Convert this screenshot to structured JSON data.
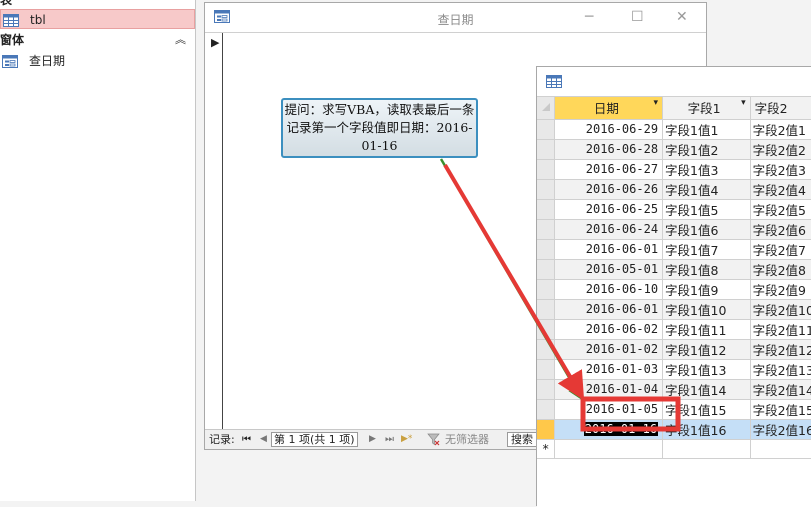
{
  "nav": {
    "group_tables": "表",
    "table_item": "tbl",
    "group_forms": "窗体",
    "form_item": "查日期",
    "collapse_glyph": "︽"
  },
  "form_window": {
    "title": "查日期",
    "minimize": "─",
    "maximize": "☐",
    "close": "✕",
    "record_selector": "▶",
    "status": {
      "record_label": "记录:",
      "first": "⏮",
      "prev": "◀",
      "position": "第 1 项(共 1 项)",
      "next": "▶",
      "last": "⏭",
      "new": "▶*",
      "filter": "无筛选器",
      "search": "搜索"
    }
  },
  "callout": {
    "text": "提问：求写VBA，读取表最后一条记录第一个字段值即日期：2016-01-16"
  },
  "datasheet": {
    "columns": [
      "日期",
      "字段1",
      "字段2"
    ],
    "sort_glyph": "▾",
    "rows": [
      {
        "date": "2016-06-29",
        "f1": "字段1值1",
        "f2": "字段2值1"
      },
      {
        "date": "2016-06-28",
        "f1": "字段1值2",
        "f2": "字段2值2"
      },
      {
        "date": "2016-06-27",
        "f1": "字段1值3",
        "f2": "字段2值3"
      },
      {
        "date": "2016-06-26",
        "f1": "字段1值4",
        "f2": "字段2值4"
      },
      {
        "date": "2016-06-25",
        "f1": "字段1值5",
        "f2": "字段2值5"
      },
      {
        "date": "2016-06-24",
        "f1": "字段1值6",
        "f2": "字段2值6"
      },
      {
        "date": "2016-06-01",
        "f1": "字段1值7",
        "f2": "字段2值7"
      },
      {
        "date": "2016-05-01",
        "f1": "字段1值8",
        "f2": "字段2值8"
      },
      {
        "date": "2016-06-10",
        "f1": "字段1值9",
        "f2": "字段2值9"
      },
      {
        "date": "2016-06-01",
        "f1": "字段1值10",
        "f2": "字段2值10"
      },
      {
        "date": "2016-06-02",
        "f1": "字段1值11",
        "f2": "字段2值11"
      },
      {
        "date": "2016-01-02",
        "f1": "字段1值12",
        "f2": "字段2值12"
      },
      {
        "date": "2016-01-03",
        "f1": "字段1值13",
        "f2": "字段2值13"
      },
      {
        "date": "2016-01-04",
        "f1": "字段1值14",
        "f2": "字段2值14"
      },
      {
        "date": "2016-01-05",
        "f1": "字段1值15",
        "f2": "字段2值15"
      },
      {
        "date": "2016-01-16",
        "f1": "字段1值16",
        "f2": "字段2值16"
      }
    ],
    "new_row_marker": "*",
    "colors": {
      "highlight_box": "#e53935",
      "arrow_red": "#e53935",
      "arrow_green": "#3a8f2e",
      "selected_cell_bg": "#000000",
      "selected_cell_fg": "#ffffff"
    }
  }
}
